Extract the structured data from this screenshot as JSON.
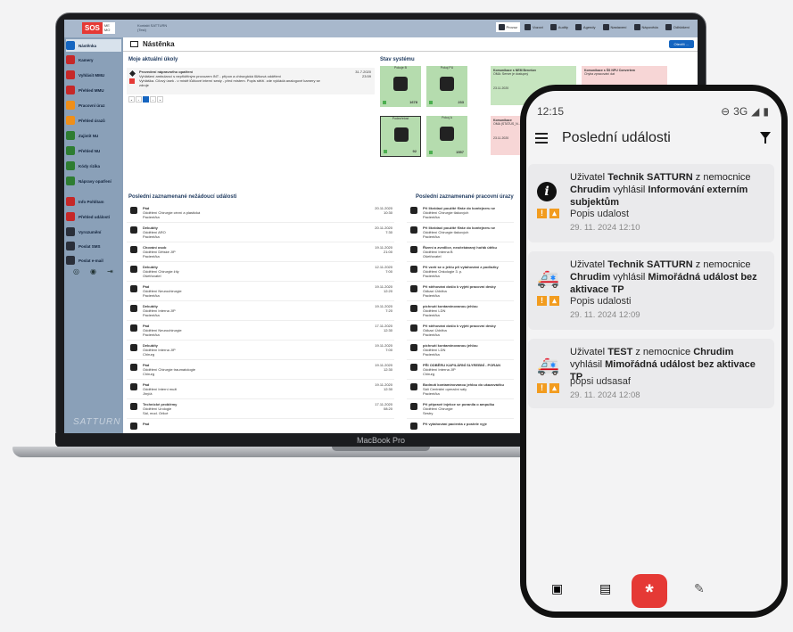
{
  "laptop": {
    "brand_label": "MacBook Pro",
    "logo": {
      "sos": "SOS",
      "mg": "ME MO"
    },
    "user_info": [
      "Kontakt SATTURN",
      "(Test)"
    ],
    "topnav": [
      {
        "label": "Provoz",
        "active": true
      },
      {
        "label": "Vozovi",
        "active": false
      },
      {
        "label": "Audity",
        "active": false
      },
      {
        "label": "Agendy",
        "active": false
      },
      {
        "label": "Nastavení",
        "active": false
      },
      {
        "label": "Nápověda",
        "active": false
      },
      {
        "label": "Odhlášení",
        "active": false
      }
    ],
    "sidebar": {
      "items": [
        {
          "label": "Nástěnka",
          "color": "#1565c0",
          "active": true
        },
        {
          "label": "Kamery",
          "color": "#c62828"
        },
        {
          "label": "Vyhlásit MMU",
          "color": "#c62828"
        },
        {
          "label": "Přehled MMU",
          "color": "#c62828"
        },
        {
          "label": "Pracovní úraz",
          "color": "#ef8f1a"
        },
        {
          "label": "Přehled úrazů",
          "color": "#ef8f1a"
        },
        {
          "label": "Zajistit NU",
          "color": "#2e7d32"
        },
        {
          "label": "Přehled NU",
          "color": "#2e7d32"
        },
        {
          "label": "Kódy rizika",
          "color": "#2e7d32"
        },
        {
          "label": "Nápravy opatření",
          "color": "#2e7d32"
        },
        {
          "label": "Info Pohlítam",
          "color": "#c62828"
        },
        {
          "label": "Přehled událostí",
          "color": "#c62828"
        },
        {
          "label": "Vyrozumění",
          "color": "#2a2f3a"
        },
        {
          "label": "Poslat SMS",
          "color": "#2a2f3a"
        },
        {
          "label": "Poslat e-mail",
          "color": "#2a2f3a"
        }
      ],
      "footer_logo": "SATTURN"
    },
    "page_title": "Nástěnka",
    "open_button": "Otevřít ...",
    "tasks_title": "Moje aktuální úkoly",
    "task": {
      "title": "Provedení nápravného opatření",
      "line1": "Vyhlášení ambulancí s nepřidělným provozem INT - přípon a chirurgická lůžková oddělení",
      "line2": "Vyhláška. Cílový úsek - v místě lůžkové interní sesty - před místem. Popis stěží. zde vykládá analogové kamery se",
      "line3": "zdroje",
      "date1": "31.7.2020",
      "date2": "23:59"
    },
    "system_title": "Stav systému",
    "tiles": [
      {
        "label": "Pokoje B",
        "num": "1678",
        "selected": false
      },
      {
        "label": "Pokoj PU",
        "num": "233",
        "selected": false
      },
      {
        "label": "Podezřelost",
        "num": "92",
        "selected": true
      },
      {
        "label": "Pokoj A",
        "num": "1557",
        "selected": false
      }
    ],
    "notices": [
      {
        "title": "Komunikace s NEM Benešov",
        "text": "OMA: Server je dostupný",
        "date": "23.11.2020",
        "color": "green"
      },
      {
        "title": "Komunikace s ŠS NPU Convertem",
        "text": "Chyba zpracování dat",
        "date": "23.11.2020",
        "color": "pink"
      },
      {
        "title": "Komunikace",
        "text": "OMA (STATUS_N...",
        "date": "23.11.2020",
        "color": "pink"
      }
    ],
    "events_title": "Poslední zaznamenané nežádoucí události",
    "events": [
      {
        "type": "Pád",
        "dept": "Oddělení Chirurgie cévní a plastická",
        "state": "Pacient/ka",
        "date": "20.11.2020",
        "time": "10:30"
      },
      {
        "type": "Dekubity",
        "dept": "Oddělení ARO",
        "state": "Pacient/ka",
        "date": "20.11.2020",
        "time": "7:30"
      },
      {
        "type": "Chování osob",
        "dept": "Oddělení Dětské JIP",
        "state": "Pacient/ka",
        "date": "19.11.2020",
        "time": "21:00"
      },
      {
        "type": "Dekubity",
        "dept": "Oddělení Chirurgie žíly",
        "state": "Ošetřovatel",
        "date": "12.11.2020",
        "time": "7:00"
      },
      {
        "type": "Pád",
        "dept": "Oddělení Neurochirurgie",
        "state": "Pacient/ka",
        "date": "19.11.2020",
        "time": "12:20"
      },
      {
        "type": "Dekubity",
        "dept": "Oddělení Interna JIP",
        "state": "Pacient/ka",
        "date": "19.11.2020",
        "time": "7:20"
      },
      {
        "type": "Pád",
        "dept": "Oddělení Neurochirurgie",
        "state": "Pacient/ka",
        "date": "17.11.2020",
        "time": "12:30"
      },
      {
        "type": "Dekubity",
        "dept": "Oddělení Interna JIP",
        "state": "Chirurg",
        "date": "19.11.2020",
        "time": "7:00"
      },
      {
        "type": "Pád",
        "dept": "Oddělení Chirurgie traumatologie",
        "state": "Chirurg",
        "date": "19.11.2020",
        "time": "12:30"
      },
      {
        "type": "Pád",
        "dept": "Oddělení Interní muži",
        "state": "Jiný/á",
        "date": "19.11.2020",
        "time": "12:30"
      },
      {
        "type": "Technické problémy",
        "dept": "Oddělení Urologie",
        "state": "Sál, mod. Orlicé",
        "date": "17.11.2020",
        "time": "08:20"
      },
      {
        "type": "Pád",
        "dept": "",
        "state": "",
        "date": "",
        "time": ""
      }
    ],
    "work_title": "Poslední zaznamenané pracovní úrazy",
    "work_events": [
      {
        "type": "Při likvidaci použité fľaše do kontejneru se",
        "dept": "Oddělení Chirurgie tlakových",
        "state": "Pacient/ka"
      },
      {
        "type": "Při likvidaci použité fľaše do kontejneru se",
        "dept": "Oddělení Chirurgie tlakových",
        "state": "Pacient/ka"
      },
      {
        "type": "Řízení a zvedlice, neočekávaný hořák útěku",
        "dept": "Oddělení Interna B",
        "state": "Ošetřovatel"
      },
      {
        "type": "Při vzetí se o jehlu při vytahování z podložky",
        "dept": "Oddělení Onkologie 3. p.",
        "state": "Pacient/ka"
      },
      {
        "type": "Při stěhování došlo k vyjetí pracovní desky",
        "dept": "Odkazí Údržba",
        "state": "Pacient/ka"
      },
      {
        "type": "píchnutí kontaminovanou jehlou",
        "dept": "Oddělení LDN",
        "state": "Pacient/ka"
      },
      {
        "type": "Při stěhování došlo k vyjetí pracovní desky",
        "dept": "Odkazí Údržba",
        "state": "Pacient/ka"
      },
      {
        "type": "píchnutí kontaminovanou jehlou",
        "dept": "Oddělení LDN",
        "state": "Pacient/ka"
      },
      {
        "type": "PŘI ODBĚRU KAPILÁRNÍ SLYREBNÍ - PORAN",
        "dept": "Oddělení Interna JIP",
        "state": "Chirurg"
      },
      {
        "type": "Bodnutí kontaminovanou jehlou do ukazováčku",
        "dept": "Sálí Centrální operační sály",
        "state": "Pacient/ka"
      },
      {
        "type": "Při přípravě injekce se poranila o ampulku",
        "dept": "Oddělení Chirurgie",
        "state": "Sestry"
      },
      {
        "type": "Při vytahování pacienta z postele vyje",
        "dept": "",
        "state": ""
      }
    ]
  },
  "phone": {
    "time": "12:15",
    "network": "3G",
    "title": "Poslední události",
    "cards": [
      {
        "icon": "info-icon",
        "prefix": "Uživatel ",
        "user": "Technik SATTURN",
        "mid1": " z nemocnice ",
        "hospital": "Chrudim",
        "mid2": " vyhlásil ",
        "event": "Informování externím subjektům",
        "desc": "Popis udalost",
        "date": "29. 11. 2024 12:10"
      },
      {
        "icon": "ambulance-icon",
        "prefix": "Uživatel ",
        "user": "Technik SATTURN",
        "mid1": " z nemocnice ",
        "hospital": "Chrudim",
        "mid2": " vyhlásil ",
        "event": "Mimořádná událost bez aktivace TP",
        "desc": "Popis udalosti",
        "date": "29. 11. 2024 12:09"
      },
      {
        "icon": "ambulance-icon",
        "prefix": "Uživatel ",
        "user": "TEST",
        "mid1": " z nemocnice ",
        "hospital": "Chrudim",
        "mid2": " vyhlásil ",
        "event": "Mimořádná událost bez aktivace TP",
        "desc": "popsi udsasaf",
        "date": "29. 11. 2024 12:08"
      }
    ],
    "fab_label": "*",
    "colors": {
      "accent": "#e53935",
      "badge": "#f29c1f"
    }
  }
}
